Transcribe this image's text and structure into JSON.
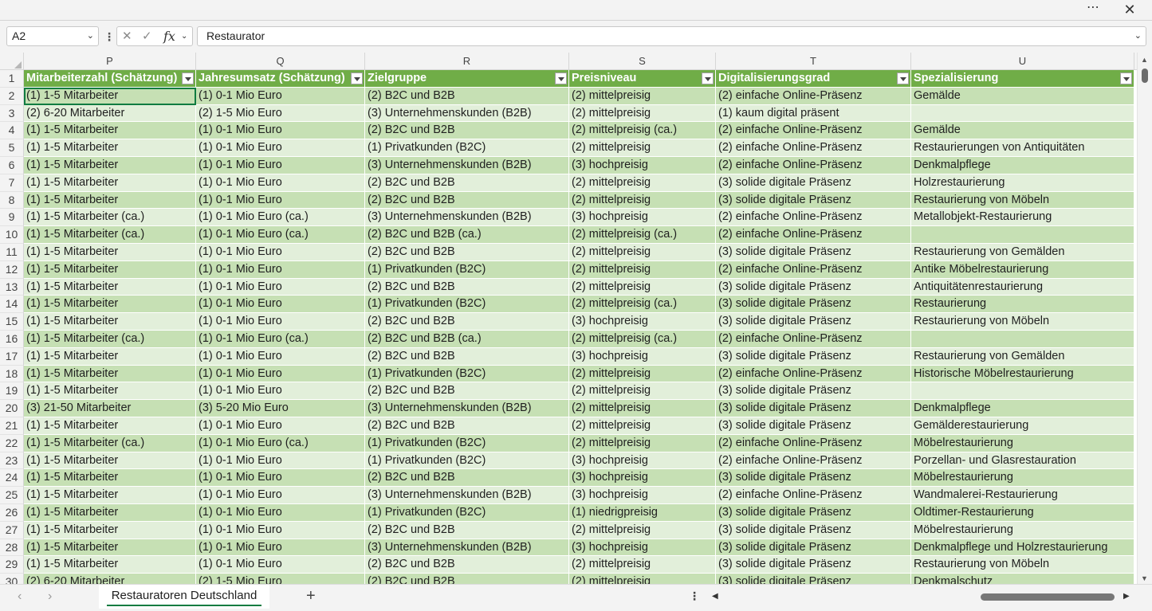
{
  "window": {
    "more_icon": "⋯",
    "close_icon": "✕"
  },
  "formula_bar": {
    "name_box": "A2",
    "cancel_icon": "✕",
    "enter_icon": "✓",
    "fx_label": "fx",
    "formula_value": "Restaurator"
  },
  "columns": [
    "P",
    "Q",
    "R",
    "S",
    "T",
    "U"
  ],
  "header_row": {
    "row_number": "1",
    "cells": [
      "Mitarbeiterzahl (Schätzung)",
      "Jahresumsatz (Schätzung)",
      "Zielgruppe",
      "Preisniveau",
      "Digitalisierungsgrad",
      "Spezialisierung"
    ]
  },
  "rows": [
    {
      "n": "2",
      "cells": [
        "(1) 1-5 Mitarbeiter",
        "(1) 0-1 Mio Euro",
        "(2) B2C und B2B",
        "(2) mittelpreisig",
        "(2) einfache Online-Präsenz",
        "Gemälde"
      ]
    },
    {
      "n": "3",
      "cells": [
        "(2) 6-20 Mitarbeiter",
        "(2) 1-5 Mio Euro",
        "(3) Unternehmenskunden (B2B)",
        "(2) mittelpreisig",
        "(1) kaum digital präsent",
        ""
      ]
    },
    {
      "n": "4",
      "cells": [
        "(1) 1-5 Mitarbeiter",
        "(1) 0-1 Mio Euro",
        "(2) B2C und B2B",
        "(2) mittelpreisig (ca.)",
        "(2) einfache Online-Präsenz",
        "Gemälde"
      ]
    },
    {
      "n": "5",
      "cells": [
        "(1) 1-5 Mitarbeiter",
        "(1) 0-1 Mio Euro",
        "(1) Privatkunden (B2C)",
        "(2) mittelpreisig",
        "(2) einfache Online-Präsenz",
        "Restaurierungen von Antiquitäten"
      ]
    },
    {
      "n": "6",
      "cells": [
        "(1) 1-5 Mitarbeiter",
        "(1) 0-1 Mio Euro",
        "(3) Unternehmenskunden (B2B)",
        "(3) hochpreisig",
        "(2) einfache Online-Präsenz",
        "Denkmalpflege"
      ]
    },
    {
      "n": "7",
      "cells": [
        "(1) 1-5 Mitarbeiter",
        "(1) 0-1 Mio Euro",
        "(2) B2C und B2B",
        "(2) mittelpreisig",
        "(3) solide digitale Präsenz",
        "Holzrestaurierung"
      ]
    },
    {
      "n": "8",
      "cells": [
        "(1) 1-5 Mitarbeiter",
        "(1) 0-1 Mio Euro",
        "(2) B2C und B2B",
        "(2) mittelpreisig",
        "(3) solide digitale Präsenz",
        "Restaurierung von Möbeln"
      ]
    },
    {
      "n": "9",
      "cells": [
        "(1) 1-5 Mitarbeiter (ca.)",
        "(1) 0-1 Mio Euro (ca.)",
        "(3) Unternehmenskunden (B2B)",
        "(3) hochpreisig",
        "(2) einfache Online-Präsenz",
        "Metallobjekt-Restaurierung"
      ]
    },
    {
      "n": "10",
      "cells": [
        "(1) 1-5 Mitarbeiter (ca.)",
        "(1) 0-1 Mio Euro (ca.)",
        "(2) B2C und B2B (ca.)",
        "(2) mittelpreisig (ca.)",
        "(2) einfache Online-Präsenz",
        ""
      ]
    },
    {
      "n": "11",
      "cells": [
        "(1) 1-5 Mitarbeiter",
        "(1) 0-1 Mio Euro",
        "(2) B2C und B2B",
        "(2) mittelpreisig",
        "(3) solide digitale Präsenz",
        "Restaurierung von Gemälden"
      ]
    },
    {
      "n": "12",
      "cells": [
        "(1) 1-5 Mitarbeiter",
        "(1) 0-1 Mio Euro",
        "(1) Privatkunden (B2C)",
        "(2) mittelpreisig",
        "(2) einfache Online-Präsenz",
        "Antike Möbelrestaurierung"
      ]
    },
    {
      "n": "13",
      "cells": [
        "(1) 1-5 Mitarbeiter",
        "(1) 0-1 Mio Euro",
        "(2) B2C und B2B",
        "(2) mittelpreisig",
        "(3) solide digitale Präsenz",
        "Antiquitätenrestaurierung"
      ]
    },
    {
      "n": "14",
      "cells": [
        "(1) 1-5 Mitarbeiter",
        "(1) 0-1 Mio Euro",
        "(1) Privatkunden (B2C)",
        "(2) mittelpreisig (ca.)",
        "(3) solide digitale Präsenz",
        "Restaurierung"
      ]
    },
    {
      "n": "15",
      "cells": [
        "(1) 1-5 Mitarbeiter",
        "(1) 0-1 Mio Euro",
        "(2) B2C und B2B",
        "(3) hochpreisig",
        "(3) solide digitale Präsenz",
        "Restaurierung von Möbeln"
      ]
    },
    {
      "n": "16",
      "cells": [
        "(1) 1-5 Mitarbeiter (ca.)",
        "(1) 0-1 Mio Euro (ca.)",
        "(2) B2C und B2B (ca.)",
        "(2) mittelpreisig (ca.)",
        "(2) einfache Online-Präsenz",
        ""
      ]
    },
    {
      "n": "17",
      "cells": [
        "(1) 1-5 Mitarbeiter",
        "(1) 0-1 Mio Euro",
        "(2) B2C und B2B",
        "(3) hochpreisig",
        "(3) solide digitale Präsenz",
        "Restaurierung von Gemälden"
      ]
    },
    {
      "n": "18",
      "cells": [
        "(1) 1-5 Mitarbeiter",
        "(1) 0-1 Mio Euro",
        "(1) Privatkunden (B2C)",
        "(2) mittelpreisig",
        "(2) einfache Online-Präsenz",
        "Historische Möbelrestaurierung"
      ]
    },
    {
      "n": "19",
      "cells": [
        "(1) 1-5 Mitarbeiter",
        "(1) 0-1 Mio Euro",
        "(2) B2C und B2B",
        "(2) mittelpreisig",
        "(3) solide digitale Präsenz",
        ""
      ]
    },
    {
      "n": "20",
      "cells": [
        "(3) 21-50 Mitarbeiter",
        "(3) 5-20 Mio Euro",
        "(3) Unternehmenskunden (B2B)",
        "(2) mittelpreisig",
        "(3) solide digitale Präsenz",
        "Denkmalpflege"
      ]
    },
    {
      "n": "21",
      "cells": [
        "(1) 1-5 Mitarbeiter",
        "(1) 0-1 Mio Euro",
        "(2) B2C und B2B",
        "(2) mittelpreisig",
        "(3) solide digitale Präsenz",
        "Gemälderestaurierung"
      ]
    },
    {
      "n": "22",
      "cells": [
        "(1) 1-5 Mitarbeiter (ca.)",
        "(1) 0-1 Mio Euro (ca.)",
        "(1) Privatkunden (B2C)",
        "(2) mittelpreisig",
        "(2) einfache Online-Präsenz",
        "Möbelrestaurierung"
      ]
    },
    {
      "n": "23",
      "cells": [
        "(1) 1-5 Mitarbeiter",
        "(1) 0-1 Mio Euro",
        "(1) Privatkunden (B2C)",
        "(3) hochpreisig",
        "(2) einfache Online-Präsenz",
        "Porzellan- und Glasrestauration"
      ]
    },
    {
      "n": "24",
      "cells": [
        "(1) 1-5 Mitarbeiter",
        "(1) 0-1 Mio Euro",
        "(2) B2C und B2B",
        "(3) hochpreisig",
        "(3) solide digitale Präsenz",
        "Möbelrestaurierung"
      ]
    },
    {
      "n": "25",
      "cells": [
        "(1) 1-5 Mitarbeiter",
        "(1) 0-1 Mio Euro",
        "(3) Unternehmenskunden (B2B)",
        "(3) hochpreisig",
        "(2) einfache Online-Präsenz",
        "Wandmalerei-Restaurierung"
      ]
    },
    {
      "n": "26",
      "cells": [
        "(1) 1-5 Mitarbeiter",
        "(1) 0-1 Mio Euro",
        "(1) Privatkunden (B2C)",
        "(1) niedrigpreisig",
        "(3) solide digitale Präsenz",
        "Oldtimer-Restaurierung"
      ]
    },
    {
      "n": "27",
      "cells": [
        "(1) 1-5 Mitarbeiter",
        "(1) 0-1 Mio Euro",
        "(2) B2C und B2B",
        "(2) mittelpreisig",
        "(3) solide digitale Präsenz",
        "Möbelrestaurierung"
      ]
    },
    {
      "n": "28",
      "cells": [
        "(1) 1-5 Mitarbeiter",
        "(1) 0-1 Mio Euro",
        "(3) Unternehmenskunden (B2B)",
        "(3) hochpreisig",
        "(3) solide digitale Präsenz",
        "Denkmalpflege und Holzrestaurierung"
      ]
    },
    {
      "n": "29",
      "cells": [
        "(1) 1-5 Mitarbeiter",
        "(1) 0-1 Mio Euro",
        "(2) B2C und B2B",
        "(2) mittelpreisig",
        "(3) solide digitale Präsenz",
        "Restaurierung von Möbeln"
      ]
    },
    {
      "n": "30",
      "cells": [
        "(2) 6-20 Mitarbeiter",
        "(2) 1-5 Mio Euro",
        "(2) B2C und B2B",
        "(2) mittelpreisig",
        "(3) solide digitale Präsenz",
        "Denkmalschutz"
      ]
    }
  ],
  "sheet_tabs": [
    "Restauratoren Deutschland"
  ],
  "tabbar": {
    "prev_icon": "‹",
    "next_icon": "›",
    "add_icon": "+",
    "options_icon": "⋮"
  },
  "colors": {
    "header_green": "#70ad47",
    "band_dark": "#c6e0b4",
    "band_light": "#e2efda",
    "accent": "#107c41"
  }
}
